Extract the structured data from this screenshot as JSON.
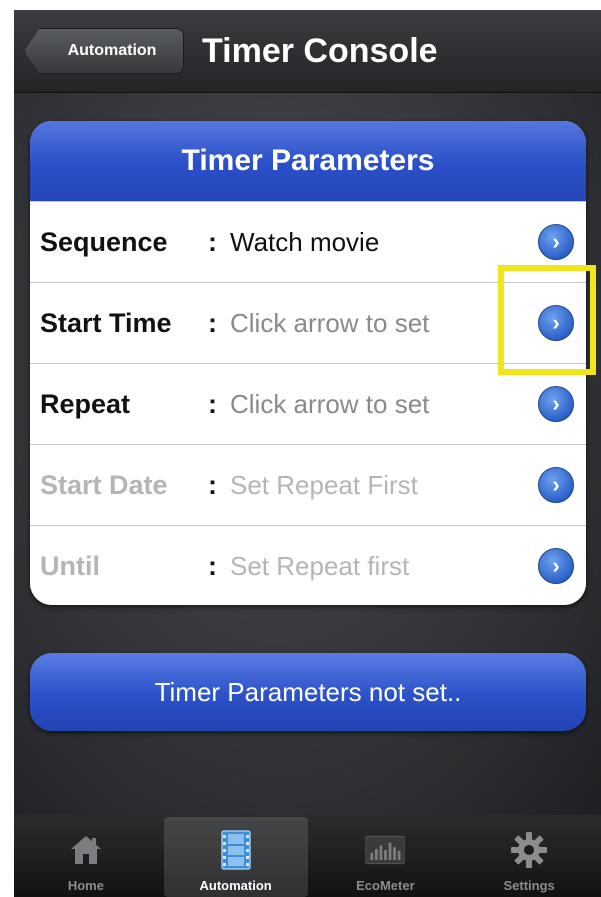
{
  "nav": {
    "back_label": "Automation",
    "title": "Timer Console"
  },
  "card": {
    "header": "Timer Parameters",
    "rows": [
      {
        "label": "Sequence",
        "colon": ":",
        "value": "Watch movie",
        "state": "set"
      },
      {
        "label": "Start Time",
        "colon": ":",
        "value": "Click arrow to set",
        "state": "unset"
      },
      {
        "label": "Repeat",
        "colon": ":",
        "value": "Click arrow to set",
        "state": "unset"
      },
      {
        "label": "Start Date",
        "colon": ":",
        "value": "Set Repeat First",
        "state": "disabled"
      },
      {
        "label": "Until",
        "colon": ":",
        "value": "Set Repeat first",
        "state": "disabled"
      }
    ]
  },
  "status_button": {
    "label": "Timer Parameters not set.."
  },
  "tabbar": {
    "tabs": [
      {
        "label": "Home",
        "icon": "home-icon",
        "active": false
      },
      {
        "label": "Automation",
        "icon": "film-icon",
        "active": true
      },
      {
        "label": "EcoMeter",
        "icon": "bar-chart-icon",
        "active": false
      },
      {
        "label": "Settings",
        "icon": "gear-icon",
        "active": false
      }
    ]
  },
  "colors": {
    "accent_blue": "#2a4fc7",
    "highlight": "#f2e51c"
  }
}
